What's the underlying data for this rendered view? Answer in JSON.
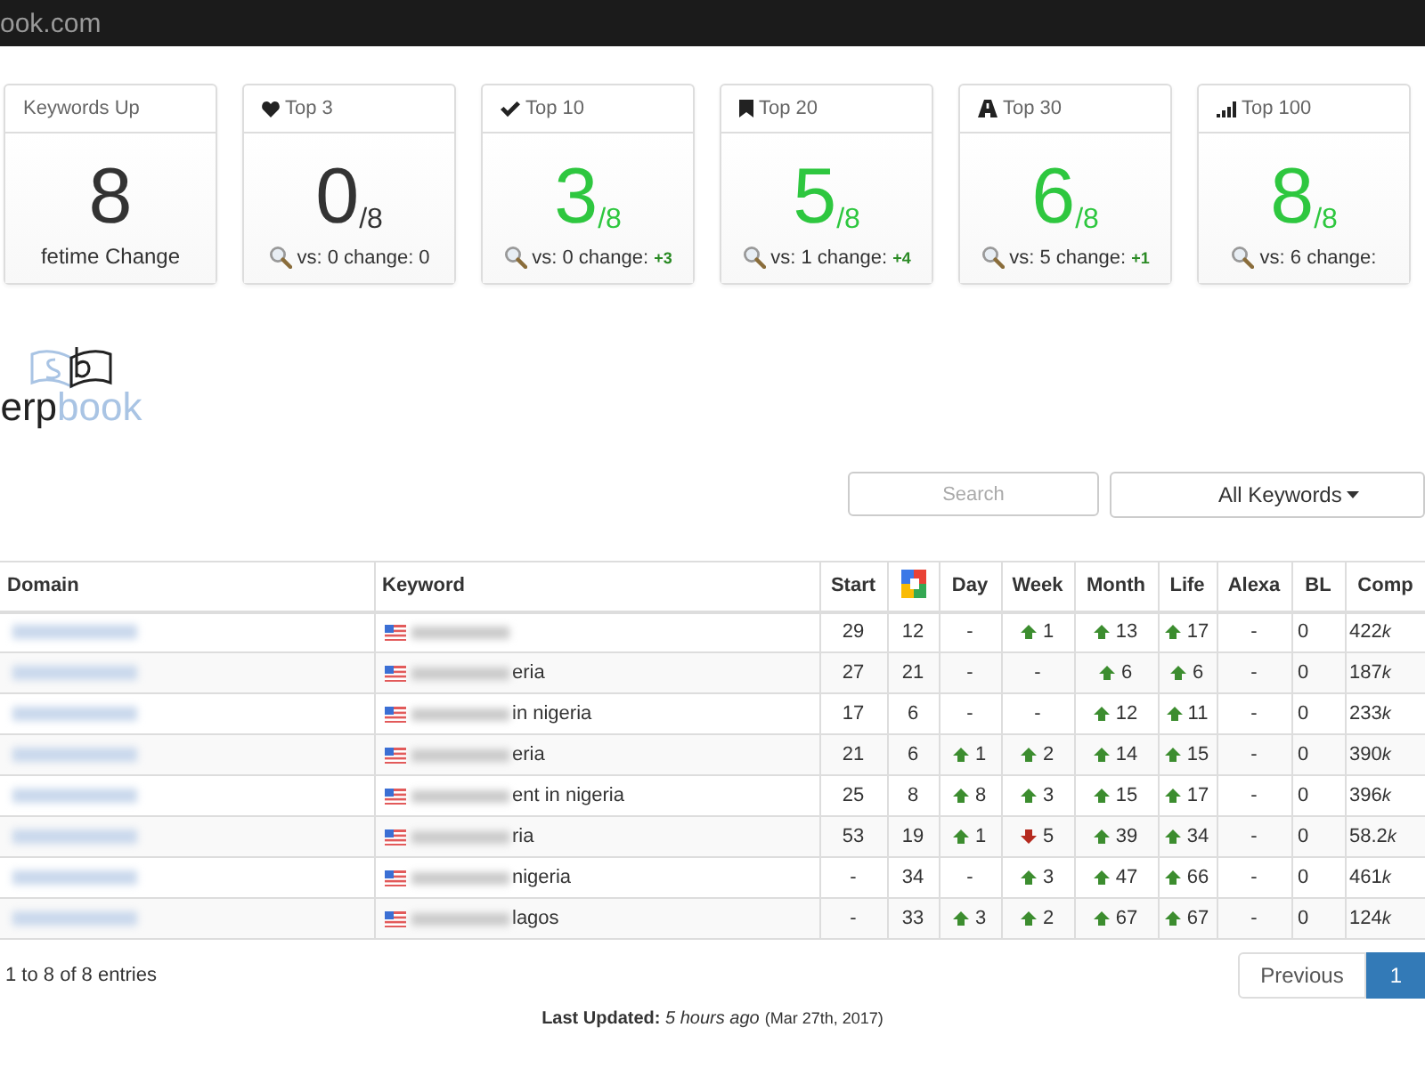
{
  "top_bar": {
    "title": "ook.com"
  },
  "cards": [
    {
      "kind": "count",
      "title": "Keywords Up",
      "value": "8",
      "caption": "fetime Change"
    },
    {
      "kind": "ratio",
      "title": "Top 3",
      "value": "0",
      "total": "/8",
      "highlight": false,
      "vs": "vs: 0 change:",
      "change": "0",
      "change_positive": false
    },
    {
      "kind": "ratio",
      "title": "Top 10",
      "value": "3",
      "total": "/8",
      "highlight": true,
      "vs": "vs: 0 change:",
      "change": "+3",
      "change_positive": true
    },
    {
      "kind": "ratio",
      "title": "Top 20",
      "value": "5",
      "total": "/8",
      "highlight": true,
      "vs": "vs: 1 change:",
      "change": "+4",
      "change_positive": true
    },
    {
      "kind": "ratio",
      "title": "Top 30",
      "value": "6",
      "total": "/8",
      "highlight": true,
      "vs": "vs: 5 change:",
      "change": "+1",
      "change_positive": true
    },
    {
      "kind": "ratio",
      "title": "Top 100",
      "value": "8",
      "total": "/8",
      "highlight": true,
      "vs": "vs: 6 change:"
    }
  ],
  "logo": {
    "dark": "erp",
    "light": "book"
  },
  "search": {
    "placeholder": "Search"
  },
  "filter": {
    "label": "All Keywords"
  },
  "table": {
    "columns": [
      {
        "kind": "text",
        "label": "Domain"
      },
      {
        "kind": "text",
        "label": "Keyword"
      },
      {
        "kind": "text",
        "label": "Start"
      },
      {
        "kind": "google"
      },
      {
        "kind": "text",
        "label": "Day"
      },
      {
        "kind": "text",
        "label": "Week"
      },
      {
        "kind": "text",
        "label": "Month"
      },
      {
        "kind": "text",
        "label": "Life"
      },
      {
        "kind": "text",
        "label": "Alexa"
      },
      {
        "kind": "text",
        "label": "BL"
      },
      {
        "kind": "text",
        "label": "Comp"
      }
    ],
    "rows": [
      {
        "start": "29",
        "rank": "12",
        "moves": [
          {
            "kind": "none",
            "text": "-"
          },
          {
            "kind": "up",
            "text": "1"
          },
          {
            "kind": "up",
            "text": "13"
          },
          {
            "kind": "up",
            "text": "17"
          }
        ],
        "alexa": "-",
        "bl": "0",
        "comp": "422",
        "comp_unit": "k"
      },
      {
        "keyword": "eria",
        "start": "27",
        "rank": "21",
        "moves": [
          {
            "kind": "none",
            "text": "-"
          },
          {
            "kind": "none",
            "text": "-"
          },
          {
            "kind": "up",
            "text": "6"
          },
          {
            "kind": "up",
            "text": "6"
          }
        ],
        "alexa": "-",
        "bl": "0",
        "comp": "187",
        "comp_unit": "k"
      },
      {
        "keyword": "in nigeria",
        "start": "17",
        "rank": "6",
        "moves": [
          {
            "kind": "none",
            "text": "-"
          },
          {
            "kind": "none",
            "text": "-"
          },
          {
            "kind": "up",
            "text": "12"
          },
          {
            "kind": "up",
            "text": "11"
          }
        ],
        "alexa": "-",
        "bl": "0",
        "comp": "233",
        "comp_unit": "k"
      },
      {
        "keyword": "eria",
        "start": "21",
        "rank": "6",
        "moves": [
          {
            "kind": "up",
            "text": "1"
          },
          {
            "kind": "up",
            "text": "2"
          },
          {
            "kind": "up",
            "text": "14"
          },
          {
            "kind": "up",
            "text": "15"
          }
        ],
        "alexa": "-",
        "bl": "0",
        "comp": "390",
        "comp_unit": "k"
      },
      {
        "keyword": "ent in nigeria",
        "start": "25",
        "rank": "8",
        "moves": [
          {
            "kind": "up",
            "text": "8"
          },
          {
            "kind": "up",
            "text": "3"
          },
          {
            "kind": "up",
            "text": "15"
          },
          {
            "kind": "up",
            "text": "17"
          }
        ],
        "alexa": "-",
        "bl": "0",
        "comp": "396",
        "comp_unit": "k"
      },
      {
        "keyword": "ria",
        "start": "53",
        "rank": "19",
        "moves": [
          {
            "kind": "up",
            "text": "1"
          },
          {
            "kind": "down",
            "text": "5"
          },
          {
            "kind": "up",
            "text": "39"
          },
          {
            "kind": "up",
            "text": "34"
          }
        ],
        "alexa": "-",
        "bl": "0",
        "comp": "58.2",
        "comp_unit": "k"
      },
      {
        "keyword": "nigeria",
        "start": "-",
        "rank": "34",
        "moves": [
          {
            "kind": "none",
            "text": "-"
          },
          {
            "kind": "up",
            "text": "3"
          },
          {
            "kind": "up",
            "text": "47"
          },
          {
            "kind": "up",
            "text": "66"
          }
        ],
        "alexa": "-",
        "bl": "0",
        "comp": "461",
        "comp_unit": "k"
      },
      {
        "keyword": "lagos",
        "start": "-",
        "rank": "33",
        "moves": [
          {
            "kind": "up",
            "text": "3"
          },
          {
            "kind": "up",
            "text": "2"
          },
          {
            "kind": "up",
            "text": "67"
          },
          {
            "kind": "up",
            "text": "67"
          }
        ],
        "alexa": "-",
        "bl": "0",
        "comp": "124",
        "comp_unit": "k"
      }
    ]
  },
  "entries_info": "1 to 8 of 8 entries",
  "pagination": [
    {
      "label": "Previous",
      "selected": false
    },
    {
      "label": "1",
      "selected": true
    }
  ],
  "last_updated": "**Last Updated:** *5 hours ago*",
  "last_updated_date": "(Mar 27th, 2017)"
}
